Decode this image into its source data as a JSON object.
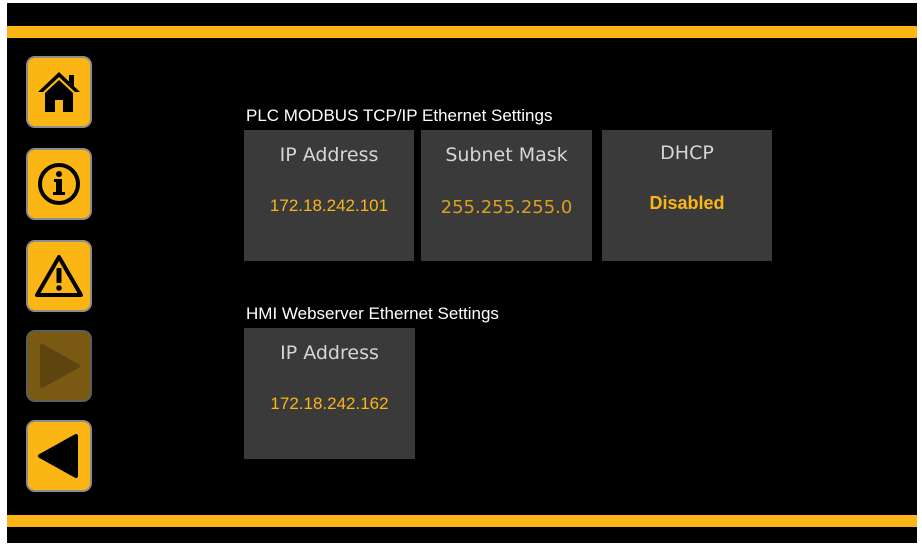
{
  "theme": {
    "accent": "#fbb616",
    "background": "#000000",
    "tile": "#3a3a3a"
  },
  "nav": {
    "home_icon": "home-icon",
    "info_icon": "info-icon",
    "warning_icon": "warning-icon",
    "forward_icon": "play-icon",
    "back_icon": "back-arrow-icon"
  },
  "plc": {
    "title": "PLC MODBUS TCP/IP Ethernet Settings",
    "ip_label": "IP Address",
    "ip_value": "172.18.242.101",
    "subnet_label": "Subnet Mask",
    "subnet_value": "255.255.255.0",
    "dhcp_label": "DHCP",
    "dhcp_value": "Disabled"
  },
  "hmi": {
    "title": "HMI Webserver Ethernet Settings",
    "ip_label": "IP Address",
    "ip_value": "172.18.242.162"
  }
}
